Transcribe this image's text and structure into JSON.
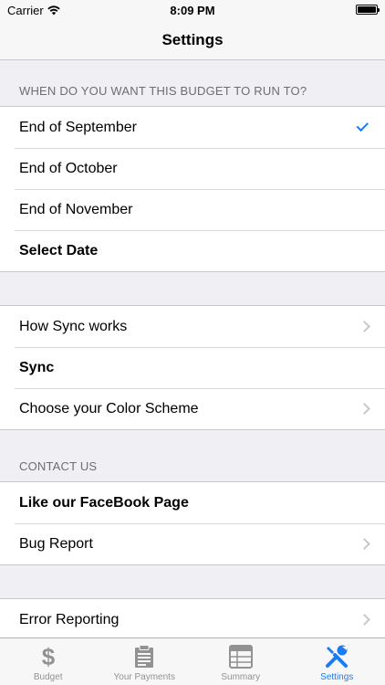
{
  "status_bar": {
    "carrier": "Carrier",
    "time": "8:09 PM"
  },
  "nav": {
    "title": "Settings"
  },
  "budget_section": {
    "header": "WHEN DO YOU WANT THIS BUDGET TO RUN TO?",
    "items": [
      {
        "label": "End of September",
        "accessory": "checkmark",
        "selected": true
      },
      {
        "label": "End of October"
      },
      {
        "label": "End of November"
      },
      {
        "label": "Select Date",
        "bold": true
      }
    ]
  },
  "sync_section": {
    "items": [
      {
        "label": "How Sync works",
        "accessory": "chevron"
      },
      {
        "label": "Sync",
        "bold": true
      },
      {
        "label": "Choose your Color Scheme",
        "accessory": "chevron"
      }
    ]
  },
  "contact_section": {
    "header": "CONTACT US",
    "items": [
      {
        "label": "Like our FaceBook Page",
        "bold": true
      },
      {
        "label": "Bug Report",
        "accessory": "chevron"
      }
    ]
  },
  "error_section": {
    "items": [
      {
        "label": "Error Reporting",
        "accessory": "chevron"
      }
    ]
  },
  "tab_bar": {
    "active_color": "#1a7cf4",
    "inactive_color": "#929292",
    "tabs": [
      {
        "label": "Budget",
        "icon": "dollar-icon"
      },
      {
        "label": "Your Payments",
        "icon": "clipboard-icon"
      },
      {
        "label": "Summary",
        "icon": "table-icon"
      },
      {
        "label": "Settings",
        "icon": "tools-icon",
        "active": true
      }
    ]
  }
}
